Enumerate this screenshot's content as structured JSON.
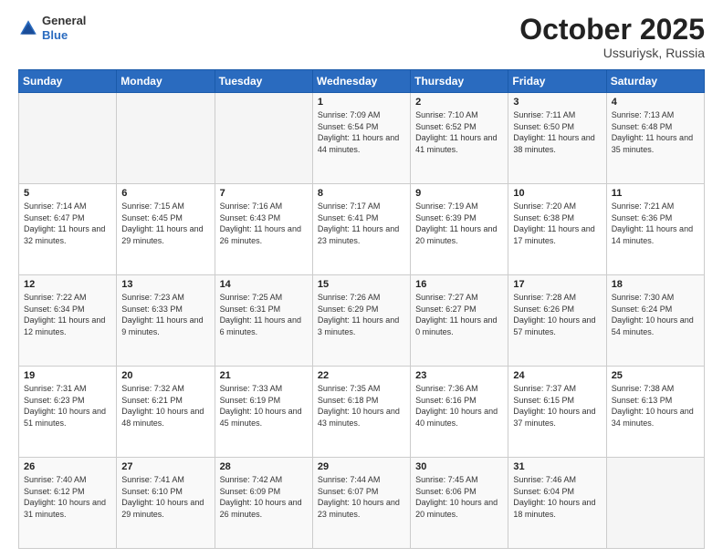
{
  "header": {
    "logo_general": "General",
    "logo_blue": "Blue",
    "month": "October 2025",
    "location": "Ussuriysk, Russia"
  },
  "weekdays": [
    "Sunday",
    "Monday",
    "Tuesday",
    "Wednesday",
    "Thursday",
    "Friday",
    "Saturday"
  ],
  "weeks": [
    [
      {
        "day": "",
        "info": ""
      },
      {
        "day": "",
        "info": ""
      },
      {
        "day": "",
        "info": ""
      },
      {
        "day": "1",
        "sunrise": "7:09 AM",
        "sunset": "6:54 PM",
        "daylight": "11 hours and 44 minutes."
      },
      {
        "day": "2",
        "sunrise": "7:10 AM",
        "sunset": "6:52 PM",
        "daylight": "11 hours and 41 minutes."
      },
      {
        "day": "3",
        "sunrise": "7:11 AM",
        "sunset": "6:50 PM",
        "daylight": "11 hours and 38 minutes."
      },
      {
        "day": "4",
        "sunrise": "7:13 AM",
        "sunset": "6:48 PM",
        "daylight": "11 hours and 35 minutes."
      }
    ],
    [
      {
        "day": "5",
        "sunrise": "7:14 AM",
        "sunset": "6:47 PM",
        "daylight": "11 hours and 32 minutes."
      },
      {
        "day": "6",
        "sunrise": "7:15 AM",
        "sunset": "6:45 PM",
        "daylight": "11 hours and 29 minutes."
      },
      {
        "day": "7",
        "sunrise": "7:16 AM",
        "sunset": "6:43 PM",
        "daylight": "11 hours and 26 minutes."
      },
      {
        "day": "8",
        "sunrise": "7:17 AM",
        "sunset": "6:41 PM",
        "daylight": "11 hours and 23 minutes."
      },
      {
        "day": "9",
        "sunrise": "7:19 AM",
        "sunset": "6:39 PM",
        "daylight": "11 hours and 20 minutes."
      },
      {
        "day": "10",
        "sunrise": "7:20 AM",
        "sunset": "6:38 PM",
        "daylight": "11 hours and 17 minutes."
      },
      {
        "day": "11",
        "sunrise": "7:21 AM",
        "sunset": "6:36 PM",
        "daylight": "11 hours and 14 minutes."
      }
    ],
    [
      {
        "day": "12",
        "sunrise": "7:22 AM",
        "sunset": "6:34 PM",
        "daylight": "11 hours and 12 minutes."
      },
      {
        "day": "13",
        "sunrise": "7:23 AM",
        "sunset": "6:33 PM",
        "daylight": "11 hours and 9 minutes."
      },
      {
        "day": "14",
        "sunrise": "7:25 AM",
        "sunset": "6:31 PM",
        "daylight": "11 hours and 6 minutes."
      },
      {
        "day": "15",
        "sunrise": "7:26 AM",
        "sunset": "6:29 PM",
        "daylight": "11 hours and 3 minutes."
      },
      {
        "day": "16",
        "sunrise": "7:27 AM",
        "sunset": "6:27 PM",
        "daylight": "11 hours and 0 minutes."
      },
      {
        "day": "17",
        "sunrise": "7:28 AM",
        "sunset": "6:26 PM",
        "daylight": "10 hours and 57 minutes."
      },
      {
        "day": "18",
        "sunrise": "7:30 AM",
        "sunset": "6:24 PM",
        "daylight": "10 hours and 54 minutes."
      }
    ],
    [
      {
        "day": "19",
        "sunrise": "7:31 AM",
        "sunset": "6:23 PM",
        "daylight": "10 hours and 51 minutes."
      },
      {
        "day": "20",
        "sunrise": "7:32 AM",
        "sunset": "6:21 PM",
        "daylight": "10 hours and 48 minutes."
      },
      {
        "day": "21",
        "sunrise": "7:33 AM",
        "sunset": "6:19 PM",
        "daylight": "10 hours and 45 minutes."
      },
      {
        "day": "22",
        "sunrise": "7:35 AM",
        "sunset": "6:18 PM",
        "daylight": "10 hours and 43 minutes."
      },
      {
        "day": "23",
        "sunrise": "7:36 AM",
        "sunset": "6:16 PM",
        "daylight": "10 hours and 40 minutes."
      },
      {
        "day": "24",
        "sunrise": "7:37 AM",
        "sunset": "6:15 PM",
        "daylight": "10 hours and 37 minutes."
      },
      {
        "day": "25",
        "sunrise": "7:38 AM",
        "sunset": "6:13 PM",
        "daylight": "10 hours and 34 minutes."
      }
    ],
    [
      {
        "day": "26",
        "sunrise": "7:40 AM",
        "sunset": "6:12 PM",
        "daylight": "10 hours and 31 minutes."
      },
      {
        "day": "27",
        "sunrise": "7:41 AM",
        "sunset": "6:10 PM",
        "daylight": "10 hours and 29 minutes."
      },
      {
        "day": "28",
        "sunrise": "7:42 AM",
        "sunset": "6:09 PM",
        "daylight": "10 hours and 26 minutes."
      },
      {
        "day": "29",
        "sunrise": "7:44 AM",
        "sunset": "6:07 PM",
        "daylight": "10 hours and 23 minutes."
      },
      {
        "day": "30",
        "sunrise": "7:45 AM",
        "sunset": "6:06 PM",
        "daylight": "10 hours and 20 minutes."
      },
      {
        "day": "31",
        "sunrise": "7:46 AM",
        "sunset": "6:04 PM",
        "daylight": "10 hours and 18 minutes."
      },
      {
        "day": "",
        "info": ""
      }
    ]
  ],
  "labels": {
    "sunrise": "Sunrise:",
    "sunset": "Sunset:",
    "daylight": "Daylight:"
  }
}
